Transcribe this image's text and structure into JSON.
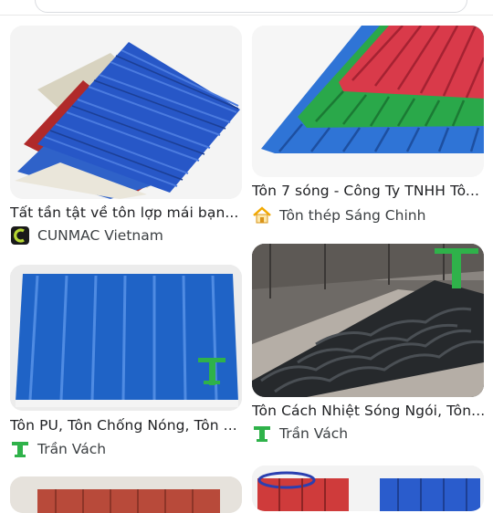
{
  "results": [
    {
      "title": "Tất tần tật về tôn lợp mái bạn...",
      "source": "CUNMAC Vietnam",
      "source_icon": "cunmac-logo-icon"
    },
    {
      "title": "Tôn 7 sóng - Công Ty TNHH Tô...",
      "source": "Tôn thép Sáng Chinh",
      "source_icon": "house-logo-icon"
    },
    {
      "title": "Tôn PU, Tôn Chống Nóng, Tôn ...",
      "source": "Trần Vách",
      "source_icon": "tran-vach-logo-icon"
    },
    {
      "title": "Tôn Cách Nhiệt Sóng Ngói, Tôn...",
      "source": "Trần Vách",
      "source_icon": "tran-vach-logo-icon"
    }
  ],
  "colors": {
    "cunmac": "#8fbf1f",
    "tran_vach": "#2fb24a",
    "house": "#f2a900"
  }
}
